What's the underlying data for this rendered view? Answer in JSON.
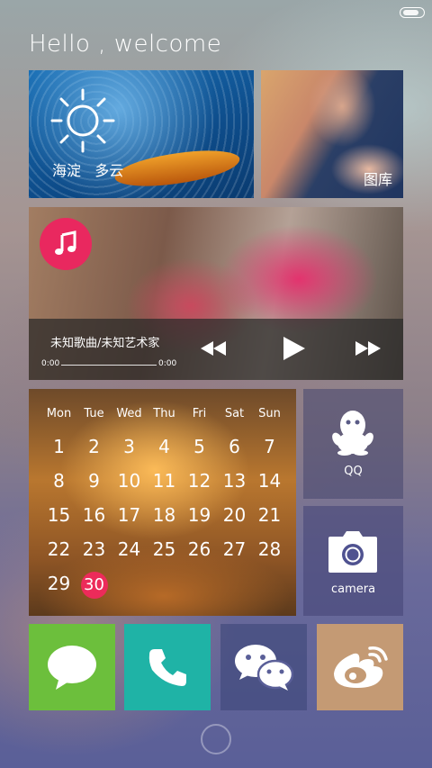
{
  "greeting": "Hello , welcome",
  "weather": {
    "location": "海淀",
    "condition": "多云",
    "icon": "sun-icon"
  },
  "gallery": {
    "label": "图库"
  },
  "music": {
    "title": "未知歌曲/未知艺术家",
    "time_start": "0:00",
    "time_end": "0:00",
    "progress": 0,
    "accent": "#e9285f"
  },
  "calendar": {
    "weekdays": [
      "Mon",
      "Tue",
      "Wed",
      "Thu",
      "Fri",
      "Sat",
      "Sun"
    ],
    "days": [
      "1",
      "2",
      "3",
      "4",
      "5",
      "6",
      "7",
      "8",
      "9",
      "10",
      "11",
      "12",
      "13",
      "14",
      "15",
      "16",
      "17",
      "18",
      "19",
      "20",
      "21",
      "22",
      "23",
      "24",
      "25",
      "26",
      "27",
      "28",
      "29",
      "30"
    ],
    "today": "30",
    "today_color": "#ec2b5a"
  },
  "apps": {
    "qq": {
      "label": "QQ",
      "icon": "qq-penguin-icon"
    },
    "camera": {
      "label": "camera",
      "icon": "camera-icon"
    },
    "messages": {
      "icon": "chat-bubble-icon",
      "color": "#6cbf3c"
    },
    "phone": {
      "icon": "phone-icon",
      "color": "#1fb3a6"
    },
    "wechat": {
      "icon": "wechat-icon"
    },
    "weibo": {
      "icon": "weibo-icon",
      "color": "#c49a74"
    }
  }
}
